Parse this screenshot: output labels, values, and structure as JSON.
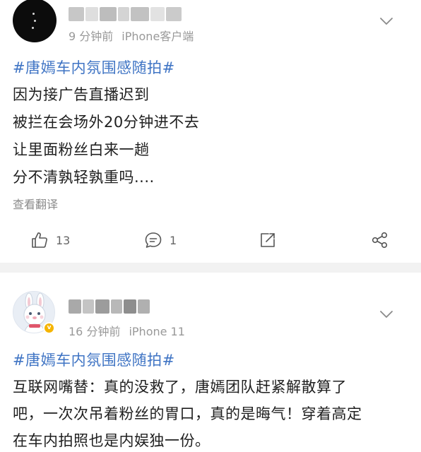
{
  "posts": [
    {
      "time": "9 分钟前",
      "client": "iPhone客户端",
      "hashtag": "#唐嫣车内氛围感随拍#",
      "lines": [
        "因为接广告直播迟到",
        "被拦在会场外20分钟进不去",
        "让里面粉丝白来一趟",
        "分不清孰轻孰重吗...."
      ],
      "translate_label": "查看翻译",
      "actions": {
        "like_count": "13",
        "comment_count": "1"
      },
      "icons": {
        "like": "thumbs-up-icon",
        "comment": "comment-icon",
        "repost": "repost-icon",
        "share": "share-icon",
        "more": "chevron-down-icon"
      }
    },
    {
      "time": "16 分钟前",
      "client": "iPhone 11",
      "hashtag": "#唐嫣车内氛围感随拍#",
      "lines": [
        "互联网嘴替：真的没救了，唐嫣团队赶紧解散算了",
        "吧，一次次吊着粉丝的胃口，真的是晦气！穿着高定",
        "在车内拍照也是内娱独一份。"
      ],
      "icons": {
        "more": "chevron-down-icon",
        "badge": "verified-badge-icon"
      }
    }
  ],
  "colors": {
    "hashtag": "#3f74c4",
    "meta": "#999999",
    "separator": "#f2f2f2",
    "badge": "#f5b400"
  }
}
